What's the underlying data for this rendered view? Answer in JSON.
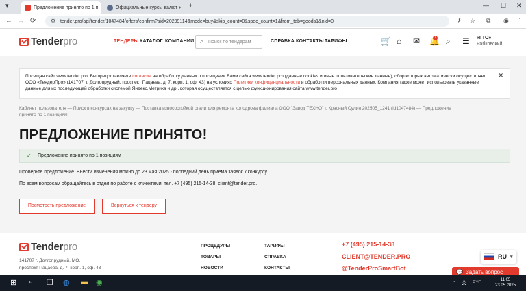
{
  "browser": {
    "tabs": [
      {
        "title": "Предложение принято по 1 п",
        "active": true
      },
      {
        "title": "Официальные курсы валют н",
        "active": false
      }
    ],
    "new_tab": "+",
    "url": "tender.pro/api/tender/1047484/offers/confirm?sid=20299114&mode=buy&skip_count=0&spec_count=1&from_tab=goods1&nid=0"
  },
  "header": {
    "logo_main": "Tender",
    "logo_suffix": "pro",
    "menu": [
      "ТЕНДЕРЫ",
      "КАТАЛОГ",
      "КОМПАНИИ"
    ],
    "search_placeholder": "Поиск по тендерам",
    "menu_right": [
      "СПРАВКА",
      "КОНТАКТЫ",
      "ТАРИФЫ"
    ],
    "notifications_count": "1",
    "user_name": "«ГТО»",
    "user_company": "Рабковский ..."
  },
  "cookie": {
    "text_1": "Посещая сайт www.tender.pro, Вы предоставляете ",
    "link_1": "согласие",
    "text_2": " на обработку данных о посещении Вами сайта www.tender.pro (данные cookies и иные пользовательские данные), сбор которых автоматически осуществляет ООО «ТендерПро» (141707, г. Долгопрудный, проспект Пацаева, д. 7, корп. 1, оф. 43) на условиях ",
    "link_2": "Политики конфиденциальности",
    "text_3": " и обработки персональных данных. Компания также может использовать указанные данные для их последующей обработки системой Яндекс.Метрика и др., которая осуществляется с целью функционирования сайта www.tender.pro"
  },
  "breadcrumbs": "Кабинет пользователя — Поиск в конкурсах на закупку — Поставка износостойкой стали для ремонта колодрова филиала ООО \"Завод ТЕХНО\" г. Красный Сулин 202505_1241 (id1047484) — Предложение принято по 1 позициям",
  "main": {
    "title": "ПРЕДЛОЖЕНИЕ ПРИНЯТО!",
    "success_message": "Предложение принято по 1 позициям",
    "note_1": "Проверьте предложение. Внести изменения можно до 23 мая 2025 - последний день приема заявок к конкурсу.",
    "note_2": "По всем вопросам обращайтесь в отдел по работе с клиентами: тел. +7 (495) 215-14-38, client@tender.pro.",
    "btn_view": "Посмотреть предложение",
    "btn_back": "Вернуться к тендеру"
  },
  "footer": {
    "address_1": "141707 г. Долгопрудный, МО,",
    "address_2": "проспект Пацаева, д. 7, корп. 1, оф. 43",
    "col1": [
      "ПРОЦЕДУРЫ",
      "ТОВАРЫ",
      "НОВОСТИ"
    ],
    "col2": [
      "ТАРИФЫ",
      "СПРАВКА",
      "КОНТАКТЫ"
    ],
    "phone": "+7 (495) 215-14-38",
    "email": "CLIENT@TENDER.PRO",
    "telegram": "@TenderProSmartBot"
  },
  "widgets": {
    "lang": "RU",
    "ask": "Задать вопрос"
  },
  "taskbar": {
    "lang": "РУС",
    "time": "11:05",
    "date": "23.05.2025"
  },
  "colors": {
    "accent": "#e23b2e"
  }
}
